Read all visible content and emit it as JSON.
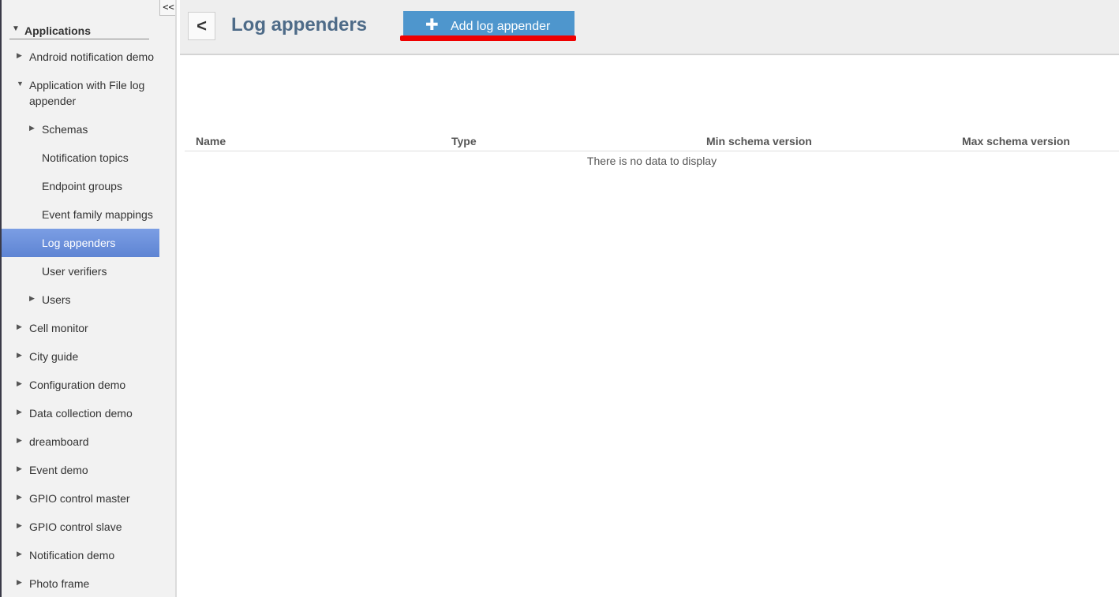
{
  "sidebar": {
    "collapse_label": "<<",
    "root_label": "Applications",
    "items": [
      {
        "label": "Android notification demo",
        "level": 1,
        "expander": "collapsed"
      },
      {
        "label": "Application with File log appender",
        "level": 1,
        "expander": "expanded"
      },
      {
        "label": "Schemas",
        "level": 2,
        "expander": "collapsed"
      },
      {
        "label": "Notification topics",
        "level": 2,
        "expander": "none"
      },
      {
        "label": "Endpoint groups",
        "level": 2,
        "expander": "none"
      },
      {
        "label": "Event family mappings",
        "level": 2,
        "expander": "none"
      },
      {
        "label": "Log appenders",
        "level": 2,
        "expander": "none",
        "selected": true
      },
      {
        "label": "User verifiers",
        "level": 2,
        "expander": "none"
      },
      {
        "label": "Users",
        "level": 2,
        "expander": "collapsed"
      },
      {
        "label": "Cell monitor",
        "level": 1,
        "expander": "collapsed"
      },
      {
        "label": "City guide",
        "level": 1,
        "expander": "collapsed"
      },
      {
        "label": "Configuration demo",
        "level": 1,
        "expander": "collapsed"
      },
      {
        "label": "Data collection demo",
        "level": 1,
        "expander": "collapsed"
      },
      {
        "label": "dreamboard",
        "level": 1,
        "expander": "collapsed"
      },
      {
        "label": "Event demo",
        "level": 1,
        "expander": "collapsed"
      },
      {
        "label": "GPIO control master",
        "level": 1,
        "expander": "collapsed"
      },
      {
        "label": "GPIO control slave",
        "level": 1,
        "expander": "collapsed"
      },
      {
        "label": "Notification demo",
        "level": 1,
        "expander": "collapsed"
      },
      {
        "label": "Photo frame",
        "level": 1,
        "expander": "collapsed"
      }
    ]
  },
  "header": {
    "back_label": "<",
    "title": "Log appenders",
    "add_button_icon": "plus-icon",
    "add_button_label": "Add log appender"
  },
  "table": {
    "columns": [
      "Name",
      "Type",
      "Min schema version",
      "Max schema version"
    ],
    "empty_message": "There is no data to display"
  },
  "colors": {
    "accent": "#4e96cd",
    "selected": "#6a8fd8",
    "title": "#4e6b88",
    "annotation": "#ef0000"
  }
}
